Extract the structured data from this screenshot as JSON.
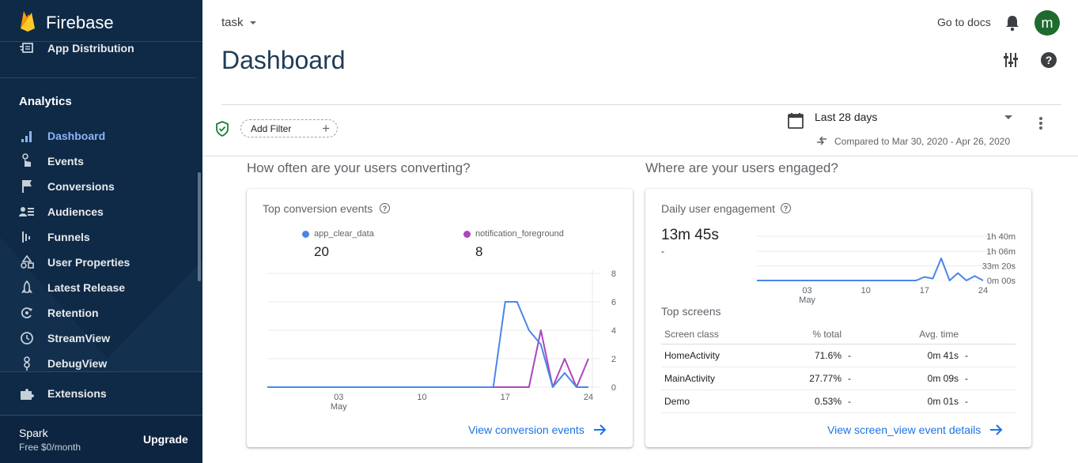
{
  "sidebar": {
    "brand": "Firebase",
    "top_item": "App Distribution",
    "section": "Analytics",
    "items": [
      {
        "label": "Dashboard",
        "icon": "bar-chart-icon"
      },
      {
        "label": "Events",
        "icon": "touch-icon"
      },
      {
        "label": "Conversions",
        "icon": "flag-icon"
      },
      {
        "label": "Audiences",
        "icon": "audience-icon"
      },
      {
        "label": "Funnels",
        "icon": "funnel-icon"
      },
      {
        "label": "User Properties",
        "icon": "user-properties-icon"
      },
      {
        "label": "Latest Release",
        "icon": "rocket-icon"
      },
      {
        "label": "Retention",
        "icon": "retention-icon"
      },
      {
        "label": "StreamView",
        "icon": "clock-icon"
      },
      {
        "label": "DebugView",
        "icon": "debug-icon"
      }
    ],
    "extensions": "Extensions",
    "plan": {
      "name": "Spark",
      "price": "Free $0/month",
      "upgrade": "Upgrade"
    }
  },
  "header": {
    "project": "task",
    "title": "Dashboard",
    "docs": "Go to docs",
    "avatar": "m"
  },
  "filter": {
    "add_filter": "Add Filter",
    "date_range": "Last 28 days",
    "compared": "Compared to Mar 30, 2020 - Apr 26, 2020"
  },
  "sections": {
    "converting": "How often are your users converting?",
    "engaged": "Where are your users engaged?"
  },
  "conversion_card": {
    "title": "Top conversion events",
    "series": [
      {
        "name": "app_clear_data",
        "total": "20",
        "color": "#4a86e8"
      },
      {
        "name": "notification_foreground",
        "total": "8",
        "color": "#ab47bc"
      }
    ],
    "link": "View conversion events"
  },
  "engagement_card": {
    "title": "Daily user engagement",
    "value": "13m 45s",
    "delta": "-",
    "top_screens_title": "Top screens",
    "columns": [
      "Screen class",
      "% total",
      "Avg. time"
    ],
    "rows": [
      {
        "screen": "HomeActivity",
        "pct": "71.6%",
        "pct_delta": "-",
        "time": "0m 41s",
        "time_delta": "-"
      },
      {
        "screen": "MainActivity",
        "pct": "27.77%",
        "pct_delta": "-",
        "time": "0m 09s",
        "time_delta": "-"
      },
      {
        "screen": "Demo",
        "pct": "0.53%",
        "pct_delta": "-",
        "time": "0m 01s",
        "time_delta": "-"
      }
    ],
    "link": "View screen_view event details"
  },
  "chart_data": [
    {
      "type": "line",
      "x_ticks": [
        "03",
        "10",
        "17",
        "24"
      ],
      "x_tick_sub": [
        "May",
        "",
        "",
        ""
      ],
      "y_ticks": [
        "8",
        "6",
        "4",
        "2",
        "0"
      ],
      "ylim": [
        0,
        8
      ],
      "x": [
        "Apr 27",
        "Apr 28",
        "Apr 29",
        "Apr 30",
        "May 1",
        "May 2",
        "May 3",
        "May 4",
        "May 5",
        "May 6",
        "May 7",
        "May 8",
        "May 9",
        "May 10",
        "May 11",
        "May 12",
        "May 13",
        "May 14",
        "May 15",
        "May 16",
        "May 17",
        "May 18",
        "May 19",
        "May 20",
        "May 21",
        "May 22",
        "May 23",
        "May 24"
      ],
      "series": [
        {
          "name": "app_clear_data",
          "values": [
            0,
            0,
            0,
            0,
            0,
            0,
            0,
            0,
            0,
            0,
            0,
            0,
            0,
            0,
            0,
            0,
            0,
            0,
            0,
            0,
            6,
            6,
            4,
            3,
            0,
            1,
            0,
            0
          ]
        },
        {
          "name": "notification_foreground",
          "values": [
            0,
            0,
            0,
            0,
            0,
            0,
            0,
            0,
            0,
            0,
            0,
            0,
            0,
            0,
            0,
            0,
            0,
            0,
            0,
            0,
            0,
            0,
            0,
            4,
            0,
            2,
            0,
            2
          ]
        }
      ]
    },
    {
      "type": "line",
      "x_ticks": [
        "03",
        "10",
        "17",
        "24"
      ],
      "x_tick_sub": [
        "May",
        "",
        "",
        ""
      ],
      "y_ticks": [
        "1h 40m",
        "1h 06m",
        "33m 20s",
        "0m 00s"
      ],
      "series": [
        {
          "values_seconds": [
            0,
            0,
            0,
            0,
            0,
            0,
            0,
            0,
            0,
            0,
            0,
            0,
            0,
            0,
            0,
            0,
            0,
            0,
            0,
            0,
            480,
            250,
            3000,
            0,
            1000,
            0,
            600,
            0
          ]
        }
      ]
    }
  ]
}
